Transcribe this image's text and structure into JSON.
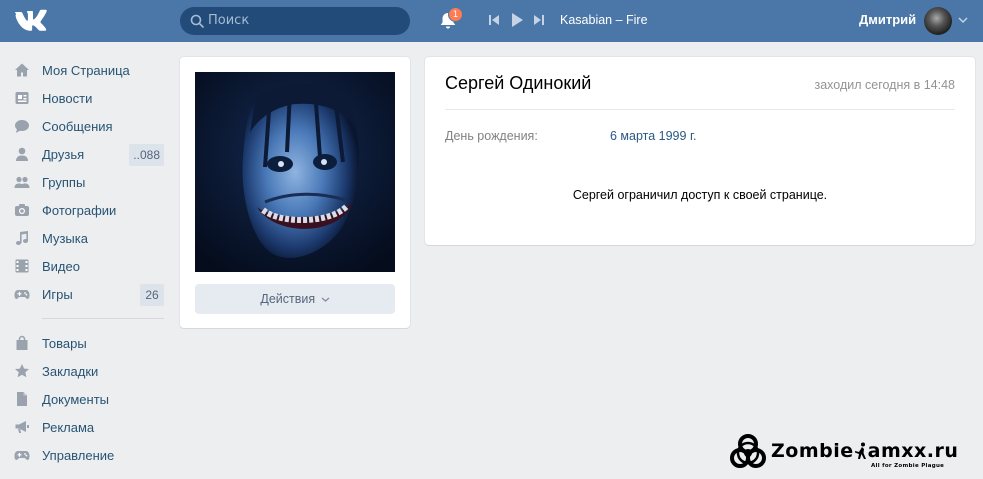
{
  "header": {
    "search_placeholder": "Поиск",
    "notification_count": "1",
    "player_track": "Kasabian – Fire",
    "user_name": "Дмитрий"
  },
  "sidebar": {
    "items": [
      {
        "label": "Моя Страница",
        "icon": "home-icon"
      },
      {
        "label": "Новости",
        "icon": "news-icon"
      },
      {
        "label": "Сообщения",
        "icon": "messages-icon"
      },
      {
        "label": "Друзья",
        "icon": "friends-icon",
        "count": "..088"
      },
      {
        "label": "Группы",
        "icon": "groups-icon"
      },
      {
        "label": "Фотографии",
        "icon": "camera-icon"
      },
      {
        "label": "Музыка",
        "icon": "music-icon"
      },
      {
        "label": "Видео",
        "icon": "video-icon"
      },
      {
        "label": "Игры",
        "icon": "games-icon",
        "count": "26"
      }
    ],
    "items2": [
      {
        "label": "Товары",
        "icon": "bag-icon"
      },
      {
        "label": "Закладки",
        "icon": "star-icon"
      },
      {
        "label": "Документы",
        "icon": "document-icon"
      },
      {
        "label": "Реклама",
        "icon": "ads-icon"
      },
      {
        "label": "Управление",
        "icon": "gamepad-icon"
      }
    ]
  },
  "profile": {
    "actions_label": "Действия",
    "name": "Сергей Одинокий",
    "last_seen": "заходил сегодня в 14:48",
    "birthday_label": "День рождения:",
    "birthday_value": "6 марта 1999 г.",
    "restricted_text": "Сергей ограничил доступ к своей странице."
  },
  "watermark": {
    "text_left": "Zombie",
    "text_right": "amxx.ru",
    "subtitle": "All for Zombie Plague"
  },
  "colors": {
    "header": "#4a76a8",
    "link": "#2a5885",
    "background": "#edeef0"
  }
}
